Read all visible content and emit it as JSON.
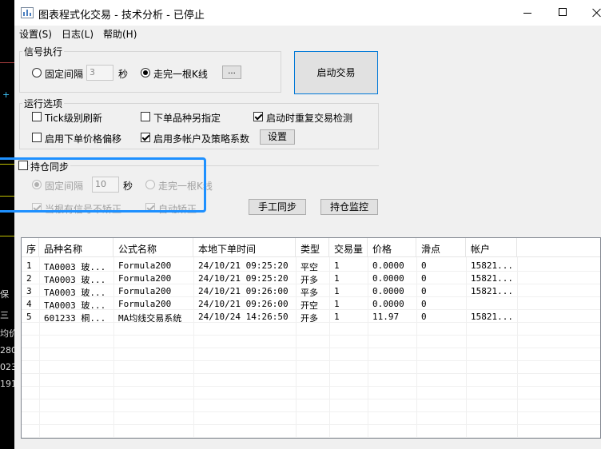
{
  "window": {
    "title": "图表程式化交易 - 技术分析 - 已停止"
  },
  "menu": [
    {
      "label": "设置(S)"
    },
    {
      "label": "日志(L)"
    },
    {
      "label": "帮助(H)"
    }
  ],
  "signal": {
    "group_title": "信号执行",
    "fixed_interval_label": "固定间隔",
    "interval_value": "3",
    "seconds_label": "秒",
    "bar_complete_label": "走完一根K线",
    "more_button": "...",
    "selected": "bar_complete"
  },
  "start_button": "启动交易",
  "options": {
    "group_title": "运行选项",
    "tick_refresh": {
      "label": "Tick级别刷新",
      "checked": false
    },
    "order_other_symbol": {
      "label": "下单品种另指定",
      "checked": false
    },
    "recheck_on_start": {
      "label": "启动时重复交易检测",
      "checked": true
    },
    "price_offset": {
      "label": "启用下单价格偏移",
      "checked": false
    },
    "multi_account": {
      "label": "启用多帐户及策略系数",
      "checked": true
    },
    "settings_button": "设置"
  },
  "position_sync": {
    "label": "持仓同步",
    "checked": false,
    "fixed_interval_label": "固定间隔",
    "interval_value": "10",
    "seconds_label": "秒",
    "bar_complete_label": "走完一根K线",
    "no_correct_on_signal": "当根有信号不矫正",
    "auto_correct": "自动矫正",
    "manual_sync_button": "手工同步",
    "position_monitor_button": "持仓监控"
  },
  "table": {
    "columns": [
      "序",
      "品种名称",
      "公式名称",
      "本地下单时间",
      "类型",
      "交易量",
      "价格",
      "滑点",
      "帐户"
    ],
    "rows": [
      [
        "1",
        "TA0003 玻...",
        "Formula200",
        "24/10/21 09:25:20",
        "平空",
        "1",
        "0.0000",
        "0",
        "15821..."
      ],
      [
        "2",
        "TA0003 玻...",
        "Formula200",
        "24/10/21 09:25:20",
        "开多",
        "1",
        "0.0000",
        "0",
        "15821..."
      ],
      [
        "3",
        "TA0003 玻...",
        "Formula200",
        "24/10/21 09:26:00",
        "平多",
        "1",
        "0.0000",
        "0",
        "15821..."
      ],
      [
        "4",
        "TA0003 玻...",
        "Formula200",
        "24/10/21 09:26:00",
        "开空",
        "1",
        "0.0000",
        "0",
        ""
      ],
      [
        "5",
        "601233 桐...",
        "MA均线交易系统",
        "24/10/24 14:26:50",
        "开多",
        "1",
        "11.97",
        "0",
        "15821..."
      ]
    ]
  },
  "background_app": {
    "texts": [
      "保",
      "三",
      "均价",
      "280",
      "023",
      "191"
    ]
  },
  "colors": {
    "highlight": "#1e90ff",
    "background": "#f0f0f0"
  }
}
